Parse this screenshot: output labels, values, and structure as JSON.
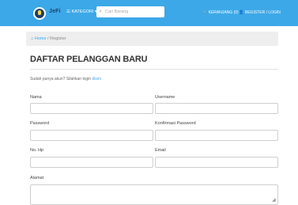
{
  "navbar": {
    "brand": "JeFi",
    "kategori_label": "☰ KATEGORI ▾",
    "search_placeholder": "Cari Barang",
    "cart_label": "🛒 KERANJANG (0)",
    "register_label": "👤 REGISTER / LOGIN",
    "color": "#3ca8e8"
  },
  "breadcrumb": {
    "home": "⌂ Home",
    "separator": " / ",
    "current": "Register"
  },
  "page": {
    "title": "DAFTAR PELANGGAN BARU",
    "hint_text": "Sudah punya akun? Silahkan login ",
    "hint_link": "disini"
  },
  "form": {
    "labels": {
      "name": "Nama",
      "username": "Username",
      "password": "Password",
      "confirm_password": "Konfirmasi Password",
      "phone": "No. Hp",
      "email": "Email",
      "address": "Alamat"
    }
  }
}
